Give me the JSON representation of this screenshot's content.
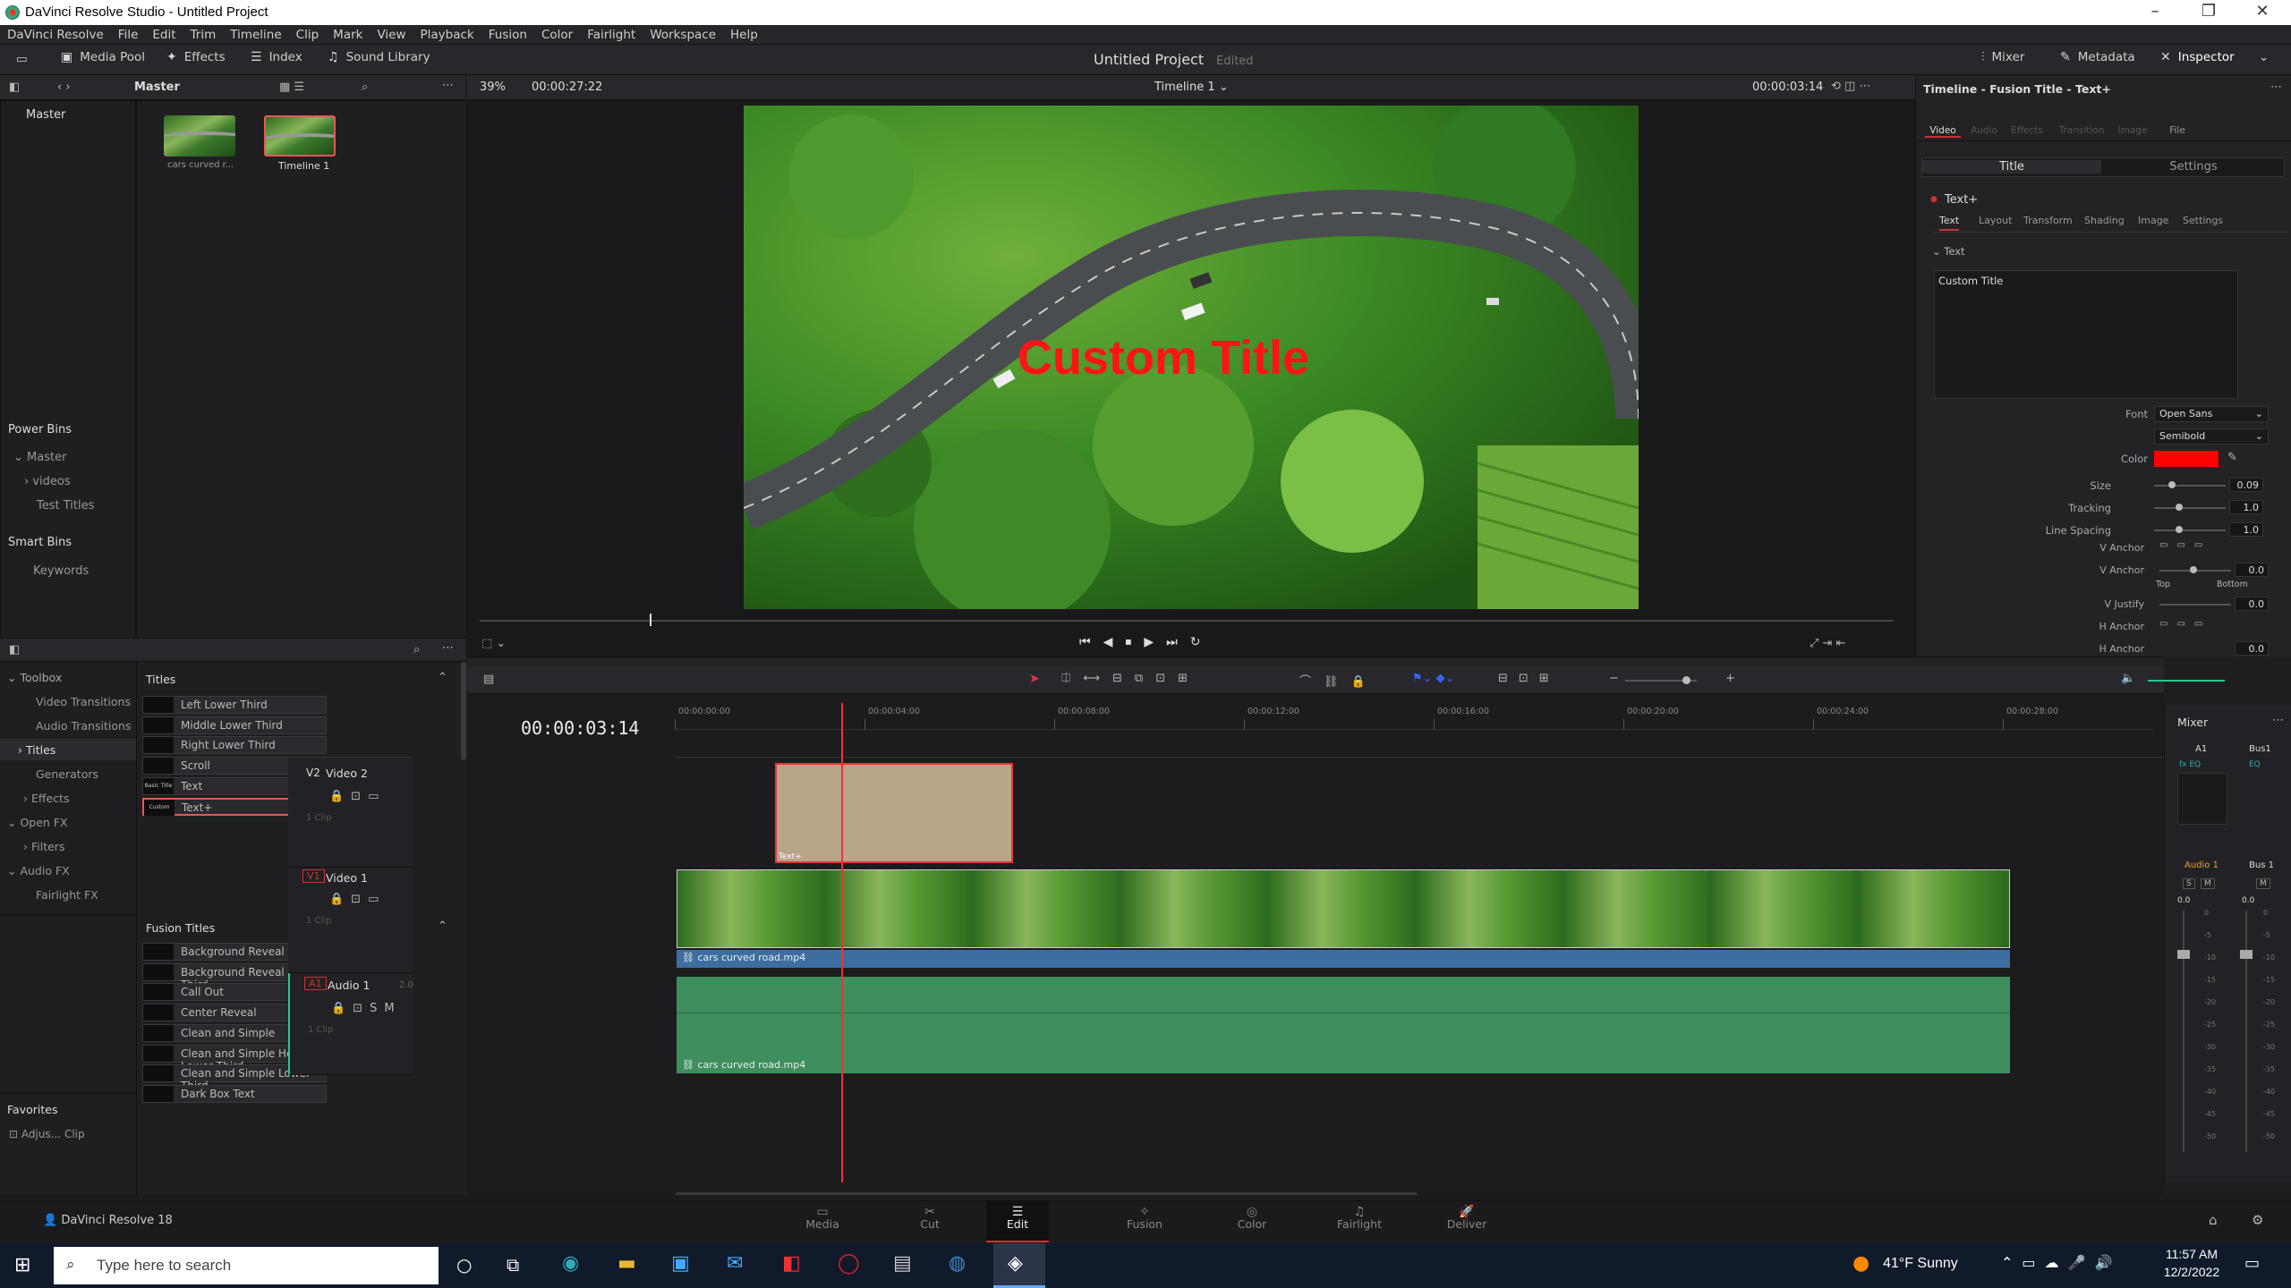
{
  "window": {
    "title": "DaVinci Resolve Studio - Untitled Project",
    "min": "–",
    "max": "❐",
    "close": "✕"
  },
  "menu": [
    "DaVinci Resolve",
    "File",
    "Edit",
    "Trim",
    "Timeline",
    "Clip",
    "Mark",
    "View",
    "Playback",
    "Fusion",
    "Color",
    "Fairlight",
    "Workspace",
    "Help"
  ],
  "toolbar": {
    "media_pool": "Media Pool",
    "effects": "Effects",
    "index": "Index",
    "sound_library": "Sound Library",
    "project_title": "Untitled Project",
    "project_status": "Edited",
    "mixer": "Mixer",
    "metadata": "Metadata",
    "inspector": "Inspector"
  },
  "media_pool": {
    "bin": "Master",
    "sidebar_master": "Master",
    "power_bins": "Power Bins",
    "power_master": "Master",
    "videos": "videos",
    "test_titles": "Test Titles",
    "smart_bins": "Smart Bins",
    "keywords": "Keywords",
    "clips": [
      {
        "name": "cars curved r..."
      },
      {
        "name": "Timeline 1"
      }
    ]
  },
  "viewer": {
    "zoom": "39%",
    "source_tc": "00:00:27:22",
    "timeline_name": "Timeline 1",
    "record_tc": "00:00:03:14",
    "overlay_title": "Custom Title",
    "playhead_fraction": 0.15
  },
  "inspector": {
    "header": "Timeline - Fusion Title - Text+",
    "tabs": [
      "Video",
      "Audio",
      "Effects",
      "Transition",
      "Image",
      "File"
    ],
    "sub_tabs": [
      "Title",
      "Settings"
    ],
    "node": "Text+",
    "text_tabs": [
      "Text",
      "Layout",
      "Transform",
      "Shading",
      "Image",
      "Settings"
    ],
    "section": "Text",
    "text_value": "Custom Title",
    "font_label": "Font",
    "font": "Open Sans",
    "weight": "Semibold",
    "color_label": "Color",
    "color": "#ff0000",
    "rows": [
      {
        "k": "Size",
        "v": "0.09",
        "pos": 0.2
      },
      {
        "k": "Tracking",
        "v": "1.0",
        "pos": 0.3
      },
      {
        "k": "Line Spacing",
        "v": "1.0",
        "pos": 0.3
      }
    ],
    "v_anchor": "V Anchor",
    "v_anchor2": "V Anchor",
    "v_anchor_val": "0.0",
    "top": "Top",
    "bottom": "Bottom",
    "v_justify": "V Justify",
    "v_justify_val": "0.0",
    "h_anchor": "H Anchor",
    "h_anchor2": "H Anchor",
    "h_anchor_val": "0.0"
  },
  "effects": {
    "toolbox": "Toolbox",
    "video_transitions": "Video Transitions",
    "audio_transitions": "Audio Transitions",
    "titles": "Titles",
    "generators": "Generators",
    "effects": "Effects",
    "open_fx": "Open FX",
    "filters": "Filters",
    "audio_fx": "Audio FX",
    "fairlight_fx": "Fairlight FX",
    "favorites": "Favorites",
    "adjust_clip": "Adjus... Clip",
    "titles_header": "Titles",
    "fusion_header": "Fusion Titles",
    "title_items": [
      {
        "sw": "",
        "name": "Left Lower Third"
      },
      {
        "sw": "",
        "name": "Middle Lower Third"
      },
      {
        "sw": "",
        "name": "Right Lower Third"
      },
      {
        "sw": "",
        "name": "Scroll"
      },
      {
        "sw": "Basic Title",
        "name": "Text"
      },
      {
        "sw": "Custom Title",
        "name": "Text+"
      }
    ],
    "fusion_items": [
      {
        "sw": "",
        "name": "Background Reveal"
      },
      {
        "sw": "",
        "name": "Background Reveal Lower Third"
      },
      {
        "sw": "",
        "name": "Call Out"
      },
      {
        "sw": "",
        "name": "Center Reveal"
      },
      {
        "sw": "",
        "name": "Clean and Simple"
      },
      {
        "sw": "",
        "name": "Clean and Simple Heading Lower Third"
      },
      {
        "sw": "",
        "name": "Clean and Simple Lower Third"
      },
      {
        "sw": "",
        "name": "Dark Box Text"
      }
    ]
  },
  "timeline": {
    "timecode": "00:00:03:14",
    "ruler": [
      "00:00:00:00",
      "00:00:04:00",
      "00:00:08:00",
      "00:00:12:00",
      "00:00:16:00",
      "00:00:20:00",
      "00:00:24:00",
      "00:00:28:00"
    ],
    "v2": {
      "tag": "V2",
      "name": "Video 2",
      "clips": "1 Clip",
      "clip_label": "Text+"
    },
    "v1": {
      "tag": "V1",
      "name": "Video 1",
      "clips": "1 Clip",
      "clip_name": "cars curved road.mp4"
    },
    "a1": {
      "tag": "A1",
      "name": "Audio 1",
      "ch": "2.0",
      "clips": "1 Clip",
      "clip_name": "cars curved road.mp4"
    }
  },
  "mixer": {
    "title": "Mixer",
    "a1": "A1",
    "bus1": "Bus1",
    "fx": "fx",
    "eq": "EQ",
    "audio1": "Audio 1",
    "bus1b": "Bus 1",
    "s": "S",
    "m": "M",
    "db_a": "0.0",
    "db_b": "0.0",
    "scale": [
      "0",
      "-5",
      "-10",
      "-15",
      "-20",
      "-25",
      "-30",
      "-35",
      "-40",
      "-45",
      "-50"
    ]
  },
  "pages": {
    "app": "DaVinci Resolve 18",
    "tabs": [
      "Media",
      "Cut",
      "Edit",
      "Fusion",
      "Color",
      "Fairlight",
      "Deliver"
    ],
    "active": "Edit"
  },
  "taskbar": {
    "search": "Type here to search",
    "weather": "41°F  Sunny",
    "time": "11:57 AM",
    "date": "12/2/2022"
  }
}
